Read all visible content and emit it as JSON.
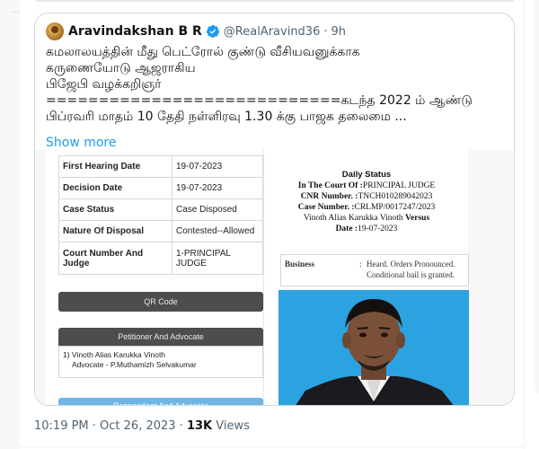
{
  "quoted_tweet": {
    "author_name": "Aravindakshan B R",
    "verified": true,
    "handle": "@RealAravind36",
    "separator": "·",
    "time": "9h",
    "text_lines": [
      "கமலாலயத்தின் மீது பெட்ரோல் குண்டு வீசியவனுக்காக",
      "கருணையோடு ஆஜராகிய",
      "பிஜேபி வழக்கறிஞர்",
      "============================கடந்த 2022 ம் ஆண்டு",
      "பிப்ரவரி மாதம் 10 தேதி நள்ளிரவு 1.30 க்கு பாஜக தலைமை ..."
    ],
    "show_more": "Show more"
  },
  "case_info": {
    "rows": [
      {
        "key": "First Hearing Date",
        "value": "19-07-2023"
      },
      {
        "key": "Decision Date",
        "value": "19-07-2023"
      },
      {
        "key": "Case Status",
        "value": "Case Disposed"
      },
      {
        "key": "Nature Of Disposal",
        "value": "Contested--Allowed"
      },
      {
        "key": "Court Number And Judge",
        "value": "1-PRINCIPAL JUDGE"
      }
    ],
    "qr_button": "QR Code",
    "petitioner_header": "Petitioner And Advocate",
    "petitioner_line1": "1) Vinoth Alias Karukka Vinoth",
    "petitioner_line2": "Advocate - P.Muthamizh Selvakumar",
    "respondent_header": "Respondent And Advocate"
  },
  "daily_status": {
    "title": "Daily Status",
    "court_label": "In The Court Of :",
    "court_value": "PRINCIPAL JUDGE",
    "cnr_label": "CNR Number. :",
    "cnr_value": "TNCH010289042023",
    "case_label": "Case Number. :",
    "case_value": "CRLMP/0017247/2023",
    "parties": "Vinoth Alias Karukka Vinoth",
    "versus": "Versus",
    "date_label": "Date :",
    "date_value": "19-07-2023",
    "business_label": "Business",
    "business_sep": ":",
    "business_value": "Heard. Orders Pronounced. Conditional bail is granted."
  },
  "footer": {
    "timestamp": "10:19 PM · Oct 26, 2023 · ",
    "views_count": "13K",
    "views_label": " Views"
  },
  "colors": {
    "link": "#1d9bf0",
    "secondary_text": "#536471",
    "verified_badge": "#1d9bf0",
    "photo_background": "#2ba3e0"
  }
}
